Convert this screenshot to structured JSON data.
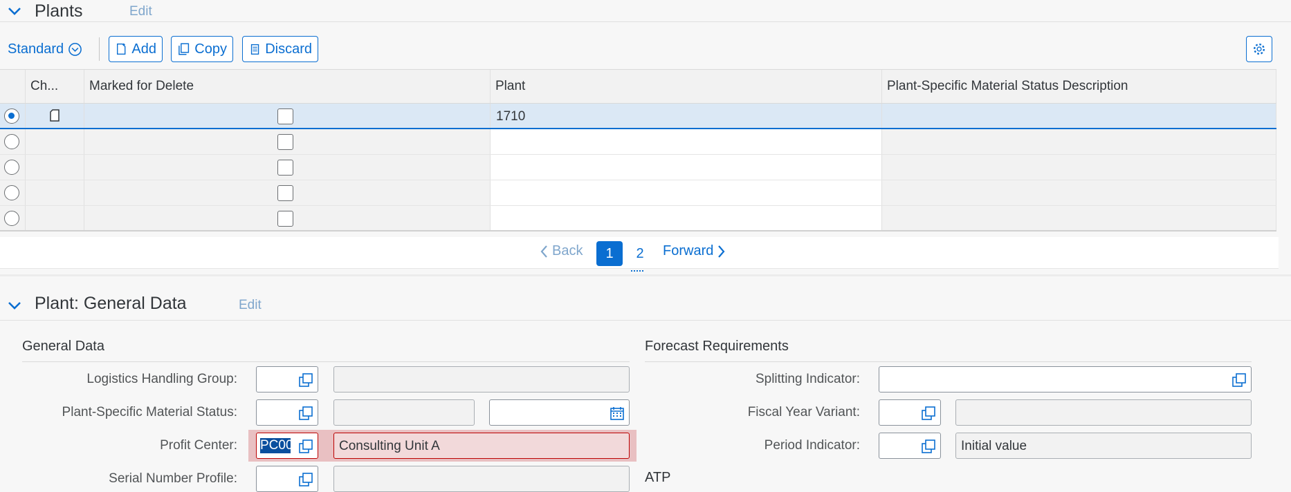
{
  "plants_section": {
    "title": "Plants",
    "edit_label": "Edit"
  },
  "toolbar": {
    "variant_label": "Standard",
    "add_label": "Add",
    "copy_label": "Copy",
    "discard_label": "Discard"
  },
  "table": {
    "columns": [
      "Ch...",
      "Marked for Delete",
      "Plant",
      "Plant-Specific Material Status Description"
    ],
    "rows": [
      {
        "selected": true,
        "plant": "1710"
      },
      {
        "selected": false,
        "plant": ""
      },
      {
        "selected": false,
        "plant": ""
      },
      {
        "selected": false,
        "plant": ""
      },
      {
        "selected": false,
        "plant": ""
      }
    ]
  },
  "pager": {
    "back_label": "Back",
    "page1": "1",
    "page2": "2",
    "forward_label": "Forward"
  },
  "general_section": {
    "title": "Plant: General Data",
    "edit_label": "Edit"
  },
  "general_data": {
    "title": "General Data",
    "logistics_label": "Logistics Handling Group:",
    "status_label": "Plant-Specific Material Status:",
    "profit_center_label": "Profit Center:",
    "profit_center_value": "PC00",
    "profit_center_desc": "Consulting Unit A",
    "serial_label": "Serial Number Profile:"
  },
  "forecast": {
    "title": "Forecast Requirements",
    "splitting_label": "Splitting Indicator:",
    "fiscal_label": "Fiscal Year Variant:",
    "period_label": "Period Indicator:",
    "period_desc": "Initial value"
  },
  "atp": {
    "title": "ATP"
  },
  "colors": {
    "accent": "#0a6ed1",
    "error_bg": "#e9c0c2",
    "selected_row": "#dbe8f5"
  }
}
